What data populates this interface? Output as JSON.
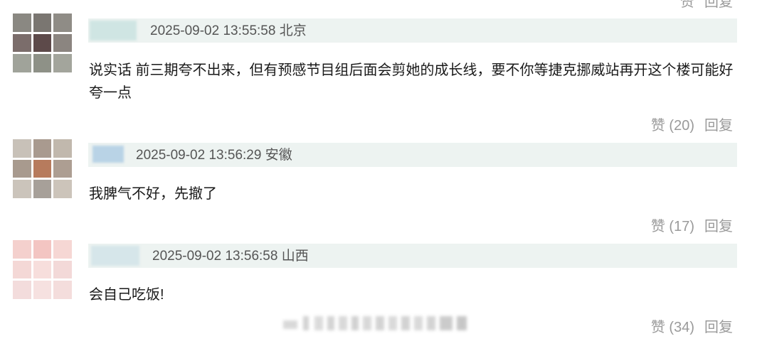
{
  "top_partial": {
    "like_label": "赞",
    "reply_label": "回复"
  },
  "comments": [
    {
      "timestamp": "2025-09-02 13:55:58",
      "location": "北京",
      "text": "说实话 前三期夸不出来，但有预感节目组后面会剪她的成长线，要不你等捷克挪威站再开这个楼可能好夸一点",
      "like_label": "赞 (20)",
      "reply_label": "回复",
      "avatar_colors": [
        "#8a8882",
        "#7a7671",
        "#8f8c86",
        "#7b6d6b",
        "#5d4a4a",
        "#8b8580",
        "#a0a39a",
        "#8e9187",
        "#a3a59c"
      ]
    },
    {
      "timestamp": "2025-09-02 13:56:29",
      "location": "安徽",
      "text": "我脾气不好，先撤了",
      "like_label": "赞 (17)",
      "reply_label": "回复",
      "avatar_colors": [
        "#c8c1b8",
        "#a99a8f",
        "#c1b8ad",
        "#a89a8e",
        "#b77b5d",
        "#ad9e92",
        "#cbc4bb",
        "#a7a099",
        "#ccc4ba"
      ]
    },
    {
      "timestamp": "2025-09-02 13:56:58",
      "location": "山西",
      "text": "会自己吃饭!",
      "like_label": "赞 (34)",
      "reply_label": "回复",
      "avatar_colors": [
        "#f4d0cd",
        "#f3c5c2",
        "#f6d7d4",
        "#f4d8d6",
        "#f7dedc",
        "#f3d9d8",
        "#f3dcdc",
        "#f6e1e0",
        "#f4dddc"
      ]
    }
  ]
}
